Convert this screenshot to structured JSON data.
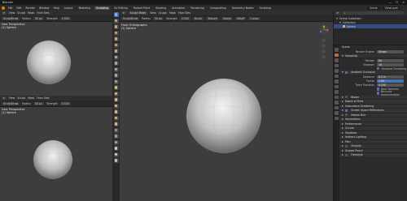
{
  "titlebar": {
    "title": "Blender",
    "min": "—",
    "max": "☐",
    "close": "✕"
  },
  "menubar": {
    "menus": [
      "File",
      "Edit",
      "Render",
      "Window",
      "Help"
    ],
    "tabs": [
      "Layout",
      "Modeling",
      "Sculpting",
      "UV Editing",
      "Texture Paint",
      "Shading",
      "Animation",
      "Rendering",
      "Compositing",
      "Geometry Nodes",
      "Scripting"
    ],
    "active_tab": "Sculpting",
    "scene": "Scene",
    "view_layer": "ViewLayer"
  },
  "viewports": {
    "top_left": {
      "label_line1": "User Perspective",
      "label_line2": "(1) Sphere"
    },
    "bottom_left": {
      "label_line1": "User Perspective",
      "label_line2": "(1) Sphere"
    },
    "main": {
      "label_line1": "Front Orthographic",
      "label_line2": "(1) Sphere"
    }
  },
  "viewport_header": {
    "menu_view": "View",
    "menu_sculpt": "Sculpt",
    "menu_mask": "Mask",
    "menu_faceset": "Face Sets",
    "brush": "SculptDraw",
    "radius_label": "Radius",
    "radius": "50 px",
    "strength_label": "Strength",
    "strength": "0.500",
    "brush_btn": "Brush",
    "texture_btn": "Texture",
    "stroke_btn": "Stroke",
    "falloff_btn": "Falloff",
    "cursor_btn": "Cursor",
    "mode": "Sculpt Mode"
  },
  "outliner": {
    "title": "Scene Collection",
    "items": [
      {
        "label": "Collection",
        "selected": false
      },
      {
        "label": "Sphere",
        "selected": true
      }
    ]
  },
  "properties": {
    "header": "Scene",
    "render_engine_label": "Render Engine",
    "render_engine": "Eevee",
    "sampling": {
      "title": "Sampling",
      "render_label": "Render",
      "render": "64",
      "viewport_label": "Viewport",
      "viewport": "16",
      "viewport_denoising": "Viewport Denoising"
    },
    "ao": {
      "title": "Ambient Occlusion",
      "distance_label": "Distance",
      "distance": "0.2 m",
      "factor_label": "Factor",
      "factor": "1.00",
      "trace_label": "Trace Precision",
      "trace": "0.250",
      "bent_normals": "Bent Normals",
      "bounce": "Bounces Approximation"
    },
    "sections": [
      "Bloom",
      "Depth of Field",
      "Subsurface Scattering",
      "Screen Space Reflections",
      "Motion Blur",
      "Volumetrics",
      "Performance",
      "Curves",
      "Shadows",
      "Indirect Lighting",
      "Film",
      "Simplify",
      "Grease Pencil",
      "Freestyle"
    ],
    "colors": {
      "accent": "#4772b3",
      "bg": "#2b2b2b"
    }
  }
}
